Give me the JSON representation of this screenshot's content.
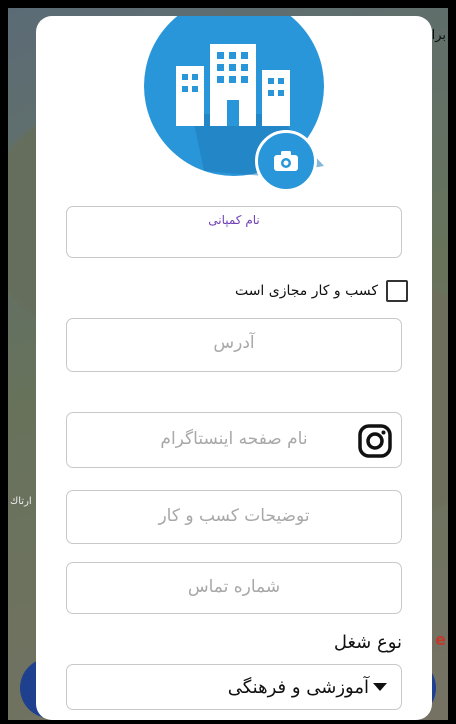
{
  "background": {
    "top_label": "برا",
    "left_label": "ارتاك",
    "right_label": "e"
  },
  "logo": {
    "icon": "building-icon",
    "camera_icon": "camera-icon"
  },
  "form": {
    "company_name_label": "نام کمپانی",
    "virtual_business_label": "کسب و کار مجازی است",
    "address_placeholder": "آدرس",
    "instagram_placeholder": "نام صفحه اینستاگرام",
    "instagram_icon": "instagram-icon",
    "description_placeholder": "توضیحات کسب و کار",
    "phone_placeholder": "شماره تماس",
    "job_type_label": "نوع شغل",
    "job_type_value": "آموزشی و فرهنگی"
  },
  "colors": {
    "accent": "#2896d9",
    "label_purple": "#6f3fb6",
    "bottom_button": "#1f3f8f"
  }
}
